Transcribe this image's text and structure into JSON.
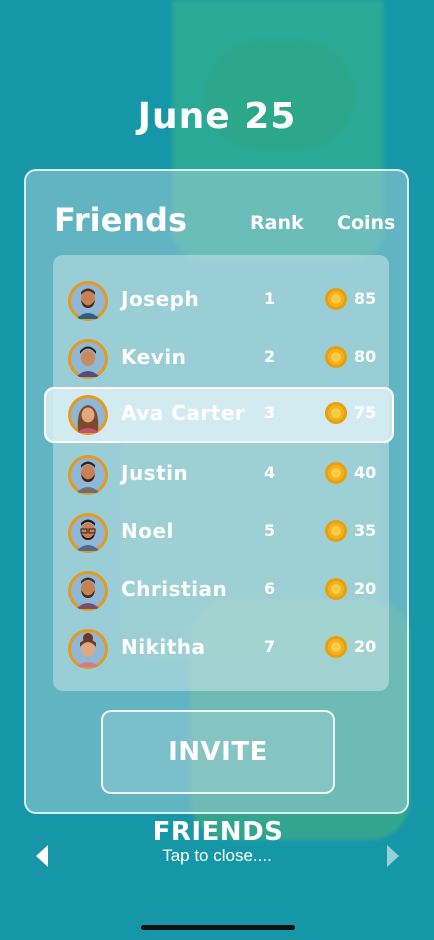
{
  "date": "June 25",
  "panel": {
    "title": "Friends",
    "rank_header": "Rank",
    "coins_header": "Coins"
  },
  "friends": [
    {
      "name": "Joseph",
      "rank": "1",
      "coins": "85",
      "avatar": "man-beard"
    },
    {
      "name": "Kevin",
      "rank": "2",
      "coins": "80",
      "avatar": "man-short-hair"
    },
    {
      "name": "Ava Carter",
      "rank": "3",
      "coins": "75",
      "avatar": "woman-brown-hair",
      "highlighted": true
    },
    {
      "name": "Justin",
      "rank": "4",
      "coins": "40",
      "avatar": "man-beard"
    },
    {
      "name": "Noel",
      "rank": "5",
      "coins": "35",
      "avatar": "man-glasses"
    },
    {
      "name": "Christian",
      "rank": "6",
      "coins": "20",
      "avatar": "man-beard"
    },
    {
      "name": "Nikitha",
      "rank": "7",
      "coins": "20",
      "avatar": "woman-bun"
    }
  ],
  "invite_button": "INVITE FRIENDS",
  "footer": {
    "tap_text": "Tap to close....",
    "prev_icon": "arrow-left-icon",
    "next_icon": "arrow-right-icon"
  },
  "colors": {
    "background": "#1597a8",
    "avatar_ring": "#e59a1e",
    "coin": "#f2b21d"
  }
}
